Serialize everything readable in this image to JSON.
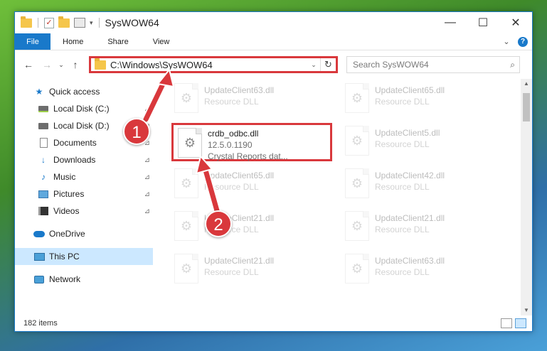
{
  "window": {
    "title": "SysWOW64",
    "min_btn": "—",
    "max_btn": "☐",
    "close_btn": "✕"
  },
  "ribbon": {
    "file_label": "File",
    "tabs": [
      "Home",
      "Share",
      "View"
    ],
    "help": "?",
    "expand": "⌄"
  },
  "nav": {
    "back": "←",
    "forward": "→",
    "recent": "⌄",
    "up": "↑",
    "address_path": "C:\\Windows\\SysWOW64",
    "address_dropdown": "⌄",
    "refresh": "↻",
    "search_placeholder": "Search SysWOW64",
    "search_icon": "⌕"
  },
  "sidebar": {
    "items": [
      {
        "label": "Quick access",
        "icon": "star-icon",
        "pin": ""
      },
      {
        "label": "Local Disk (C:)",
        "icon": "drive-icon",
        "pin": "📌"
      },
      {
        "label": "Local Disk (D:)",
        "icon": "drive-icon",
        "pin": "📌"
      },
      {
        "label": "Documents",
        "icon": "documents-icon",
        "pin": "📌"
      },
      {
        "label": "Downloads",
        "icon": "downloads-icon",
        "pin": "📌"
      },
      {
        "label": "Music",
        "icon": "music-icon",
        "pin": "📌"
      },
      {
        "label": "Pictures",
        "icon": "pictures-icon",
        "pin": "📌"
      },
      {
        "label": "Videos",
        "icon": "videos-icon",
        "pin": "📌"
      },
      {
        "label": "OneDrive",
        "icon": "onedrive-icon",
        "pin": ""
      },
      {
        "label": "This PC",
        "icon": "pc-icon",
        "pin": ""
      },
      {
        "label": "Network",
        "icon": "network-icon",
        "pin": ""
      }
    ]
  },
  "files": [
    {
      "name": "UpdateClient63.dll",
      "sub": "Resource DLL"
    },
    {
      "name": "UpdateClient65.dll",
      "sub": "Resource DLL"
    },
    {
      "name": "crdb_odbc.dll",
      "sub": "12.5.0.1190",
      "sub2": "Crystal Reports dat..."
    },
    {
      "name": "UpdateClient5.dll",
      "sub": "Resource DLL"
    },
    {
      "name": "UpdateClient65.dll",
      "sub": "Resource DLL"
    },
    {
      "name": "UpdateClient42.dll",
      "sub": "Resource DLL"
    },
    {
      "name": "UpdateClient21.dll",
      "sub": "Resource DLL"
    },
    {
      "name": "UpdateClient21.dll",
      "sub": "Resource DLL"
    },
    {
      "name": "UpdateClient21.dll",
      "sub": "Resource DLL"
    },
    {
      "name": "UpdateClient63.dll",
      "sub": "Resource DLL"
    }
  ],
  "status": {
    "item_count": "182 items"
  },
  "callouts": [
    "1",
    "2"
  ],
  "colors": {
    "accent": "#1979ca",
    "highlight": "#d9383c"
  }
}
